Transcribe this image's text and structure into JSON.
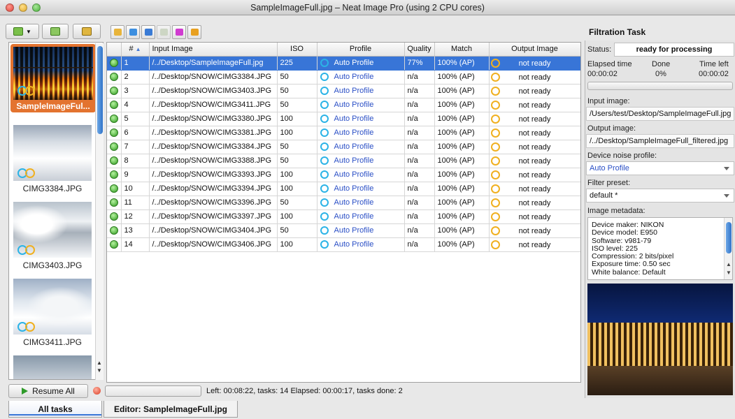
{
  "window": {
    "title": "SampleImageFull.jpg – Neat Image Pro (using 2 CPU cores)"
  },
  "thumbnails": [
    {
      "name": "SampleImageFul...",
      "selected": true
    },
    {
      "name": "CIMG3384.JPG"
    },
    {
      "name": "CIMG3403.JPG"
    },
    {
      "name": "CIMG3411.JPG"
    }
  ],
  "table": {
    "headers": [
      "#",
      "Input Image",
      "ISO",
      "Profile",
      "Quality",
      "Match",
      "Output Image"
    ],
    "rows": [
      {
        "num": "1",
        "input": "/../Desktop/SampleImageFull.jpg",
        "iso": "225",
        "profile": "Auto Profile",
        "quality": "77%",
        "match": "100% (AP)",
        "output": "not ready"
      },
      {
        "num": "2",
        "input": "/../Desktop/SNOW/CIMG3384.JPG",
        "iso": "50",
        "profile": "Auto Profile",
        "quality": "n/a",
        "match": "100% (AP)",
        "output": "not ready"
      },
      {
        "num": "3",
        "input": "/../Desktop/SNOW/CIMG3403.JPG",
        "iso": "50",
        "profile": "Auto Profile",
        "quality": "n/a",
        "match": "100% (AP)",
        "output": "not ready"
      },
      {
        "num": "4",
        "input": "/../Desktop/SNOW/CIMG3411.JPG",
        "iso": "50",
        "profile": "Auto Profile",
        "quality": "n/a",
        "match": "100% (AP)",
        "output": "not ready"
      },
      {
        "num": "5",
        "input": "/../Desktop/SNOW/CIMG3380.JPG",
        "iso": "100",
        "profile": "Auto Profile",
        "quality": "n/a",
        "match": "100% (AP)",
        "output": "not ready"
      },
      {
        "num": "6",
        "input": "/../Desktop/SNOW/CIMG3381.JPG",
        "iso": "100",
        "profile": "Auto Profile",
        "quality": "n/a",
        "match": "100% (AP)",
        "output": "not ready"
      },
      {
        "num": "7",
        "input": "/../Desktop/SNOW/CIMG3384.JPG",
        "iso": "50",
        "profile": "Auto Profile",
        "quality": "n/a",
        "match": "100% (AP)",
        "output": "not ready"
      },
      {
        "num": "8",
        "input": "/../Desktop/SNOW/CIMG3388.JPG",
        "iso": "50",
        "profile": "Auto Profile",
        "quality": "n/a",
        "match": "100% (AP)",
        "output": "not ready"
      },
      {
        "num": "9",
        "input": "/../Desktop/SNOW/CIMG3393.JPG",
        "iso": "100",
        "profile": "Auto Profile",
        "quality": "n/a",
        "match": "100% (AP)",
        "output": "not ready"
      },
      {
        "num": "10",
        "input": "/../Desktop/SNOW/CIMG3394.JPG",
        "iso": "100",
        "profile": "Auto Profile",
        "quality": "n/a",
        "match": "100% (AP)",
        "output": "not ready"
      },
      {
        "num": "11",
        "input": "/../Desktop/SNOW/CIMG3396.JPG",
        "iso": "50",
        "profile": "Auto Profile",
        "quality": "n/a",
        "match": "100% (AP)",
        "output": "not ready"
      },
      {
        "num": "12",
        "input": "/../Desktop/SNOW/CIMG3397.JPG",
        "iso": "100",
        "profile": "Auto Profile",
        "quality": "n/a",
        "match": "100% (AP)",
        "output": "not ready"
      },
      {
        "num": "13",
        "input": "/../Desktop/SNOW/CIMG3404.JPG",
        "iso": "50",
        "profile": "Auto Profile",
        "quality": "n/a",
        "match": "100% (AP)",
        "output": "not ready"
      },
      {
        "num": "14",
        "input": "/../Desktop/SNOW/CIMG3406.JPG",
        "iso": "100",
        "profile": "Auto Profile",
        "quality": "n/a",
        "match": "100% (AP)",
        "output": "not ready"
      }
    ]
  },
  "status_bar": {
    "resume_label": "Resume All",
    "text": "Left: 00:08:22, tasks: 14  Elapsed: 00:00:17, tasks done: 2"
  },
  "bottom_tabs": [
    "All tasks",
    "Editor: SampleImageFull.jpg"
  ],
  "filtration": {
    "title": "Filtration Task",
    "status_label": "Status:",
    "status_value": "ready for processing",
    "elapsed_label": "Elapsed time",
    "done_label": "Done",
    "time_left_label": "Time left",
    "elapsed_value": "00:00:02",
    "done_value": "0%",
    "time_left_value": "00:00:02",
    "input_image_label": "Input image:",
    "input_image_value": "/Users/test/Desktop/SampleImageFull.jpg",
    "output_image_label": "Output image:",
    "output_image_value": "/../Desktop/SampleImageFull_filtered.jpg",
    "noise_profile_label": "Device noise profile:",
    "noise_profile_value": "Auto Profile",
    "filter_preset_label": "Filter preset:",
    "filter_preset_value": "default *",
    "metadata_label": "Image metadata:",
    "metadata": [
      "Device maker: NIKON",
      "Device model: E950",
      "Software: v981-79",
      "ISO level: 225",
      "Compression: 2 bits/pixel",
      "Exposure time: 0.50 sec",
      "White balance: Default"
    ]
  },
  "colors": {
    "selection": "#3875d7",
    "thumb_selected": "#e3732f",
    "profile_ring": "#2bb3e6",
    "output_ring": "#f0b020",
    "status_ok": "#2e9a1e"
  },
  "icons": {
    "left_toolbar": [
      "add-images-icon",
      "edit-icon",
      "edit-batch-icon"
    ],
    "center_toolbar": [
      "edit-profile-icon",
      "open-folder-icon",
      "open-profile-icon",
      "view-icon",
      "filter-preset-icon",
      "save-icon"
    ]
  }
}
